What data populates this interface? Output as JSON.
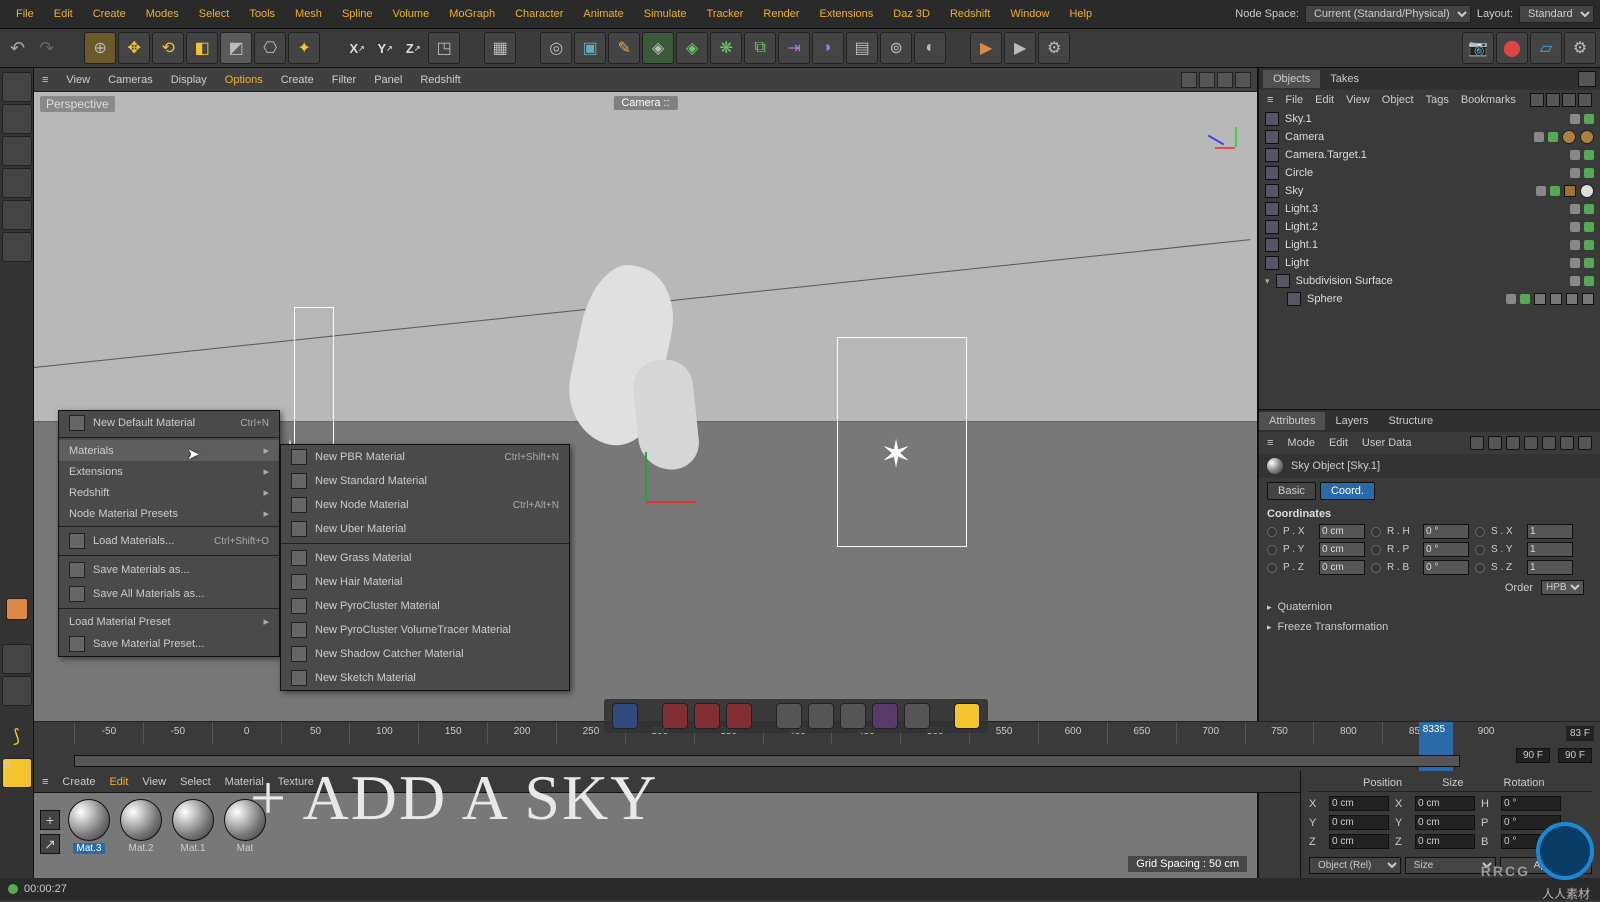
{
  "menubar": [
    "File",
    "Edit",
    "Create",
    "Modes",
    "Select",
    "Tools",
    "Mesh",
    "Spline",
    "Volume",
    "MoGraph",
    "Character",
    "Animate",
    "Simulate",
    "Tracker",
    "Render",
    "Extensions",
    "Daz 3D",
    "Redshift",
    "Window",
    "Help"
  ],
  "topright": {
    "nodespace_label": "Node Space:",
    "nodespace_value": "Current (Standard/Physical)",
    "layout_label": "Layout:",
    "layout_value": "Standard"
  },
  "viewmenu": [
    "View",
    "Cameras",
    "Display",
    "Options",
    "Create",
    "Filter",
    "Panel",
    "Redshift"
  ],
  "viewport": {
    "persp": "Perspective",
    "cam": "Camera ::",
    "grid": "Grid Spacing : 50 cm"
  },
  "ctx1": [
    {
      "label": "New Default Material",
      "shortcut": "Ctrl+N",
      "icon": "plus"
    },
    {
      "sep": true
    },
    {
      "label": "Materials",
      "sub": true,
      "hl": true
    },
    {
      "label": "Extensions",
      "sub": true
    },
    {
      "label": "Redshift",
      "sub": true
    },
    {
      "label": "Node Material Presets",
      "sub": true
    },
    {
      "sep": true
    },
    {
      "label": "Load Materials...",
      "shortcut": "Ctrl+Shift+O",
      "icon": "open"
    },
    {
      "sep": true
    },
    {
      "label": "Save Materials as...",
      "icon": "save"
    },
    {
      "label": "Save All Materials as...",
      "icon": "save"
    },
    {
      "sep": true
    },
    {
      "label": "Load Material Preset",
      "sub": true
    },
    {
      "label": "Save Material Preset...",
      "icon": "save"
    }
  ],
  "ctx2": [
    {
      "label": "New PBR Material",
      "shortcut": "Ctrl+Shift+N"
    },
    {
      "label": "New Standard Material"
    },
    {
      "label": "New Node Material",
      "shortcut": "Ctrl+Alt+N"
    },
    {
      "label": "New Uber Material"
    },
    {
      "sep": true
    },
    {
      "label": "New Grass Material"
    },
    {
      "label": "New Hair Material"
    },
    {
      "label": "New PyroCluster Material"
    },
    {
      "label": "New PyroCluster VolumeTracer Material"
    },
    {
      "label": "New Shadow Catcher Material"
    },
    {
      "label": "New Sketch Material"
    }
  ],
  "matmenu": [
    "Create",
    "Edit",
    "View",
    "Select",
    "Material",
    "Texture"
  ],
  "materials": [
    {
      "name": "Mat.3",
      "sel": true
    },
    {
      "name": "Mat.2"
    },
    {
      "name": "Mat.1"
    },
    {
      "name": "Mat"
    }
  ],
  "timeline": {
    "ticks": [
      "-50",
      "-50",
      "0",
      "50",
      "100",
      "150",
      "200",
      "250",
      "300",
      "350",
      "400",
      "450",
      "500",
      "550",
      "600",
      "650",
      "700",
      "750",
      "800",
      "850",
      "900"
    ],
    "cur": "8335",
    "fend1": "83 F",
    "f1": "90 F",
    "f2": "90 F"
  },
  "transform": {
    "headers": [
      "Position",
      "Size",
      "Rotation"
    ],
    "rows": [
      {
        "axis": "X",
        "p": "0 cm",
        "s": "0 cm",
        "r": "0 °",
        "sl": "X",
        "rl": "H"
      },
      {
        "axis": "Y",
        "p": "0 cm",
        "s": "0 cm",
        "r": "0 °",
        "sl": "Y",
        "rl": "P"
      },
      {
        "axis": "Z",
        "p": "0 cm",
        "s": "0 cm",
        "r": "0 °",
        "sl": "Z",
        "rl": "B"
      }
    ],
    "sel1": "Object (Rel)",
    "sel2": "Size",
    "apply": "Apply"
  },
  "objtabs": [
    "Objects",
    "Takes"
  ],
  "objmenu": [
    "File",
    "Edit",
    "View",
    "Object",
    "Tags",
    "Bookmarks"
  ],
  "tree": [
    {
      "name": "Sky.1",
      "icon": "sky",
      "tags": [
        "gr",
        "g"
      ]
    },
    {
      "name": "Camera",
      "icon": "cam",
      "tags": [
        "gr",
        "g"
      ],
      "extra": 2
    },
    {
      "name": "Camera.Target.1",
      "icon": "target",
      "tags": [
        "gr",
        "g"
      ]
    },
    {
      "name": "Circle",
      "icon": "circle",
      "tags": [
        "gr",
        "g"
      ]
    },
    {
      "name": "Sky",
      "icon": "sky",
      "tags": [
        "gr",
        "g"
      ],
      "matslot": true
    },
    {
      "name": "Light.3",
      "icon": "light",
      "tags": [
        "gr",
        "g"
      ]
    },
    {
      "name": "Light.2",
      "icon": "light",
      "tags": [
        "gr",
        "g"
      ]
    },
    {
      "name": "Light.1",
      "icon": "light",
      "tags": [
        "gr",
        "g"
      ]
    },
    {
      "name": "Light",
      "icon": "light",
      "tags": [
        "gr",
        "g"
      ]
    },
    {
      "name": "Subdivision Surface",
      "icon": "subd",
      "tags": [
        "gr",
        "g"
      ],
      "expand": true
    },
    {
      "name": "Sphere",
      "icon": "sphere",
      "tags": [
        "gr",
        "g"
      ],
      "indent": 1,
      "tagsrow": 4
    }
  ],
  "attr": {
    "atabs": [
      "Attributes",
      "Layers",
      "Structure"
    ],
    "abar": [
      "Mode",
      "Edit",
      "User Data"
    ],
    "objname": "Sky Object [Sky.1]",
    "mode_basic": "Basic",
    "mode_coord": "Coord.",
    "sect": "Coordinates",
    "coords": [
      {
        "p": "P . X",
        "pv": "0 cm",
        "r": "R . H",
        "rv": "0 °",
        "s": "S . X",
        "sv": "1"
      },
      {
        "p": "P . Y",
        "pv": "0 cm",
        "r": "R . P",
        "rv": "0 °",
        "s": "S . Y",
        "sv": "1"
      },
      {
        "p": "P . Z",
        "pv": "0 cm",
        "r": "R . B",
        "rv": "0 °",
        "s": "S . Z",
        "sv": "1"
      }
    ],
    "order_label": "Order",
    "order_value": "HPB",
    "fold1": "Quaternion",
    "fold2": "Freeze Transformation"
  },
  "status": "00:00:27",
  "bigtext": "+ ADD A SKY",
  "watermark": "人人素材"
}
